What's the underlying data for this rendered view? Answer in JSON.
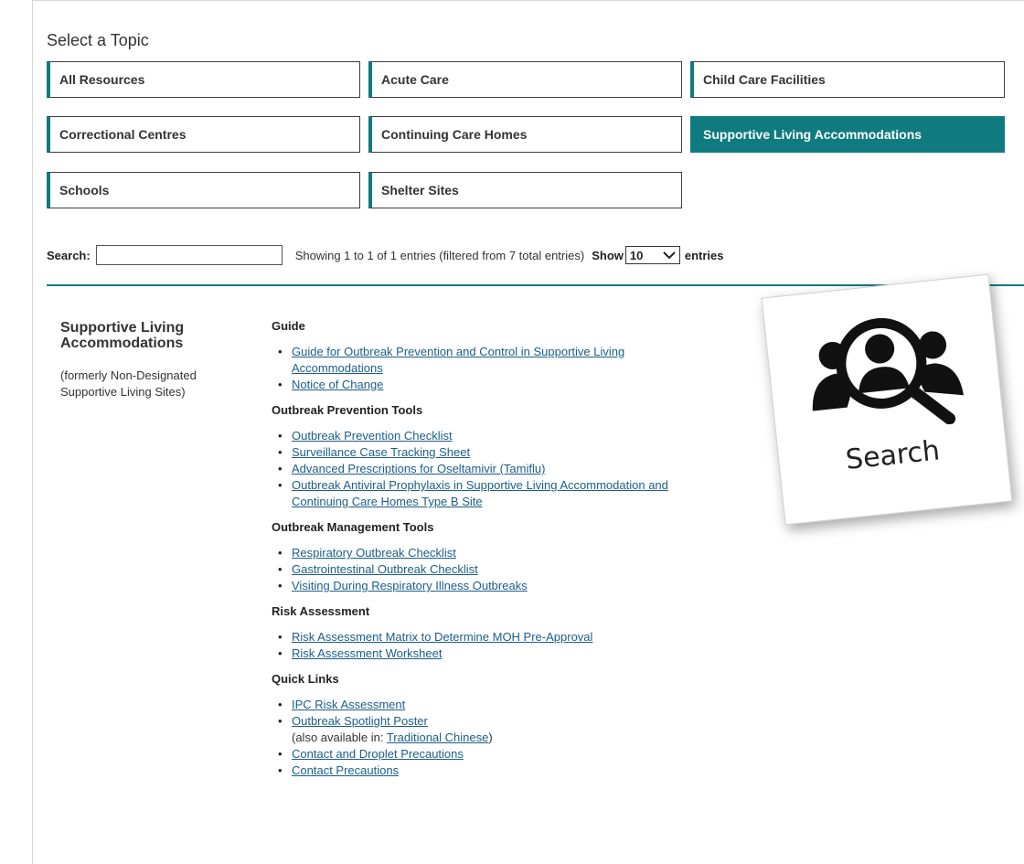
{
  "heading": "Select a Topic",
  "topics": [
    {
      "label": "All Resources",
      "active": false
    },
    {
      "label": "Acute Care",
      "active": false
    },
    {
      "label": "Child Care Facilities",
      "active": false
    },
    {
      "label": "Correctional Centres",
      "active": false
    },
    {
      "label": "Continuing Care Homes",
      "active": false
    },
    {
      "label": "Supportive Living Accommodations",
      "active": true
    },
    {
      "label": "Schools",
      "active": false
    },
    {
      "label": "Shelter Sites",
      "active": false
    }
  ],
  "search": {
    "label": "Search:",
    "value": "",
    "info": "Showing 1 to 1 of 1 entries (filtered from 7 total entries)",
    "show_label": "Show",
    "show_value": "10",
    "entries_label": "entries"
  },
  "topic_entry": {
    "name": "Supportive Living Accommodations",
    "note": "(formerly Non-Designated Supportive Living Sites)"
  },
  "sections": [
    {
      "title": "Guide",
      "links": [
        "Guide for Outbreak Prevention and Control in Supportive Living Accommodations",
        "Notice of Change"
      ]
    },
    {
      "title": "Outbreak Prevention Tools",
      "links": [
        "Outbreak Prevention Checklist",
        "Surveillance Case Tracking Sheet",
        "Advanced Prescriptions for Oseltamivir (Tamiflu)",
        "Outbreak Antiviral Prophylaxis in Supportive Living Accommodation and Continuing Care Homes Type B Site"
      ]
    },
    {
      "title": "Outbreak Management Tools",
      "links": [
        "Respiratory Outbreak Checklist",
        "Gastrointestinal Outbreak Checklist",
        "Visiting During Respiratory Illness Outbreaks"
      ]
    },
    {
      "title": "Risk Assessment",
      "links": [
        "Risk Assessment Matrix to Determine MOH Pre-Approval",
        "Risk Assessment Worksheet"
      ]
    }
  ],
  "quick_links": {
    "title": "Quick Links",
    "link1": "IPC Risk Assessment",
    "link2": "Outbreak Spotlight Poster",
    "also_prefix": "(also available in: ",
    "also_link": "Traditional Chinese",
    "also_suffix": ")",
    "link3": "Contact and Droplet Precautions",
    "link4": "Contact Precautions"
  },
  "search_card": {
    "label": "Search",
    "icon": "user-search-icon"
  },
  "colors": {
    "accent": "#0f7b7f",
    "link": "#1a5e8a"
  }
}
